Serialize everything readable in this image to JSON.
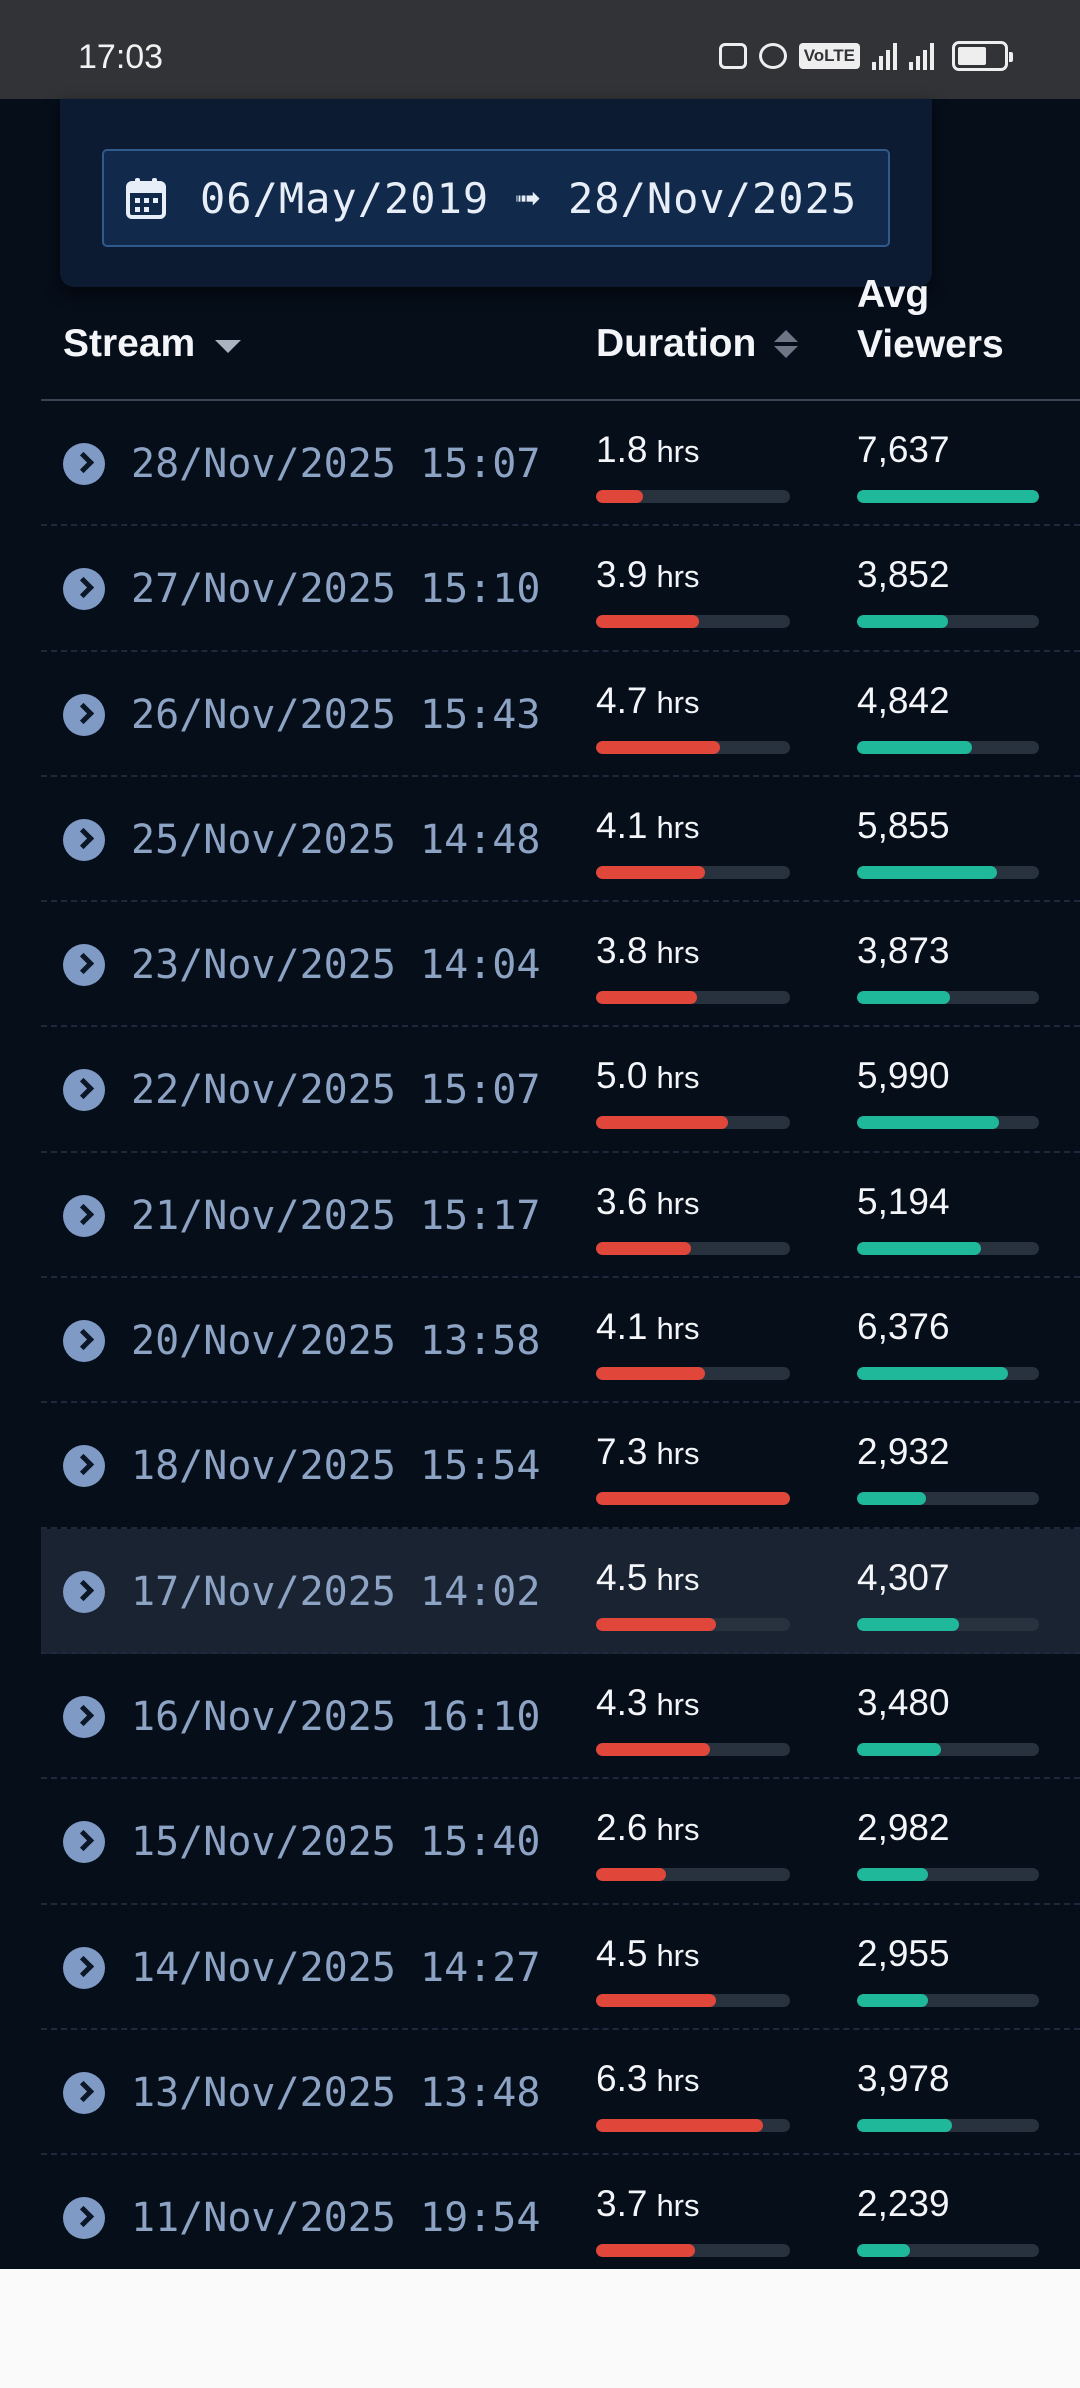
{
  "status_bar": {
    "time": "17:03",
    "icons": [
      "nfc-icon",
      "alarm-icon",
      "volte-icon",
      "signal-icon",
      "signal-4g-icon",
      "battery-icon"
    ],
    "volte_label": "VoLTE"
  },
  "filter": {
    "date_range": "06/May/2019 ➟ 28/Nov/2025",
    "icon": "calendar-icon"
  },
  "table": {
    "headers": {
      "stream": "Stream",
      "duration": "Duration",
      "avg_viewers_line1": "Avg",
      "avg_viewers_line2": "Viewers"
    },
    "unit": "hrs",
    "colors": {
      "duration_bar": "#e0473a",
      "viewers_bar": "#1fb89b",
      "link": "#8da3c4"
    },
    "rows": [
      {
        "date": "28/Nov/2025 15:07",
        "duration": "1.8",
        "duration_fill": 0.24,
        "viewers": "7,637",
        "viewers_fill": 1.0
      },
      {
        "date": "27/Nov/2025 15:10",
        "duration": "3.9",
        "duration_fill": 0.53,
        "viewers": "3,852",
        "viewers_fill": 0.5
      },
      {
        "date": "26/Nov/2025 15:43",
        "duration": "4.7",
        "duration_fill": 0.64,
        "viewers": "4,842",
        "viewers_fill": 0.63
      },
      {
        "date": "25/Nov/2025 14:48",
        "duration": "4.1",
        "duration_fill": 0.56,
        "viewers": "5,855",
        "viewers_fill": 0.77
      },
      {
        "date": "23/Nov/2025 14:04",
        "duration": "3.8",
        "duration_fill": 0.52,
        "viewers": "3,873",
        "viewers_fill": 0.51
      },
      {
        "date": "22/Nov/2025 15:07",
        "duration": "5.0",
        "duration_fill": 0.68,
        "viewers": "5,990",
        "viewers_fill": 0.78
      },
      {
        "date": "21/Nov/2025 15:17",
        "duration": "3.6",
        "duration_fill": 0.49,
        "viewers": "5,194",
        "viewers_fill": 0.68
      },
      {
        "date": "20/Nov/2025 13:58",
        "duration": "4.1",
        "duration_fill": 0.56,
        "viewers": "6,376",
        "viewers_fill": 0.83
      },
      {
        "date": "18/Nov/2025 15:54",
        "duration": "7.3",
        "duration_fill": 1.0,
        "viewers": "2,932",
        "viewers_fill": 0.38
      },
      {
        "date": "17/Nov/2025 14:02",
        "duration": "4.5",
        "duration_fill": 0.62,
        "viewers": "4,307",
        "viewers_fill": 0.56,
        "highlighted": true
      },
      {
        "date": "16/Nov/2025 16:10",
        "duration": "4.3",
        "duration_fill": 0.59,
        "viewers": "3,480",
        "viewers_fill": 0.46
      },
      {
        "date": "15/Nov/2025 15:40",
        "duration": "2.6",
        "duration_fill": 0.36,
        "viewers": "2,982",
        "viewers_fill": 0.39
      },
      {
        "date": "14/Nov/2025 14:27",
        "duration": "4.5",
        "duration_fill": 0.62,
        "viewers": "2,955",
        "viewers_fill": 0.39
      },
      {
        "date": "13/Nov/2025 13:48",
        "duration": "6.3",
        "duration_fill": 0.86,
        "viewers": "3,978",
        "viewers_fill": 0.52
      },
      {
        "date": "11/Nov/2025 19:54",
        "duration": "3.7",
        "duration_fill": 0.51,
        "viewers": "2,239",
        "viewers_fill": 0.29
      }
    ]
  }
}
